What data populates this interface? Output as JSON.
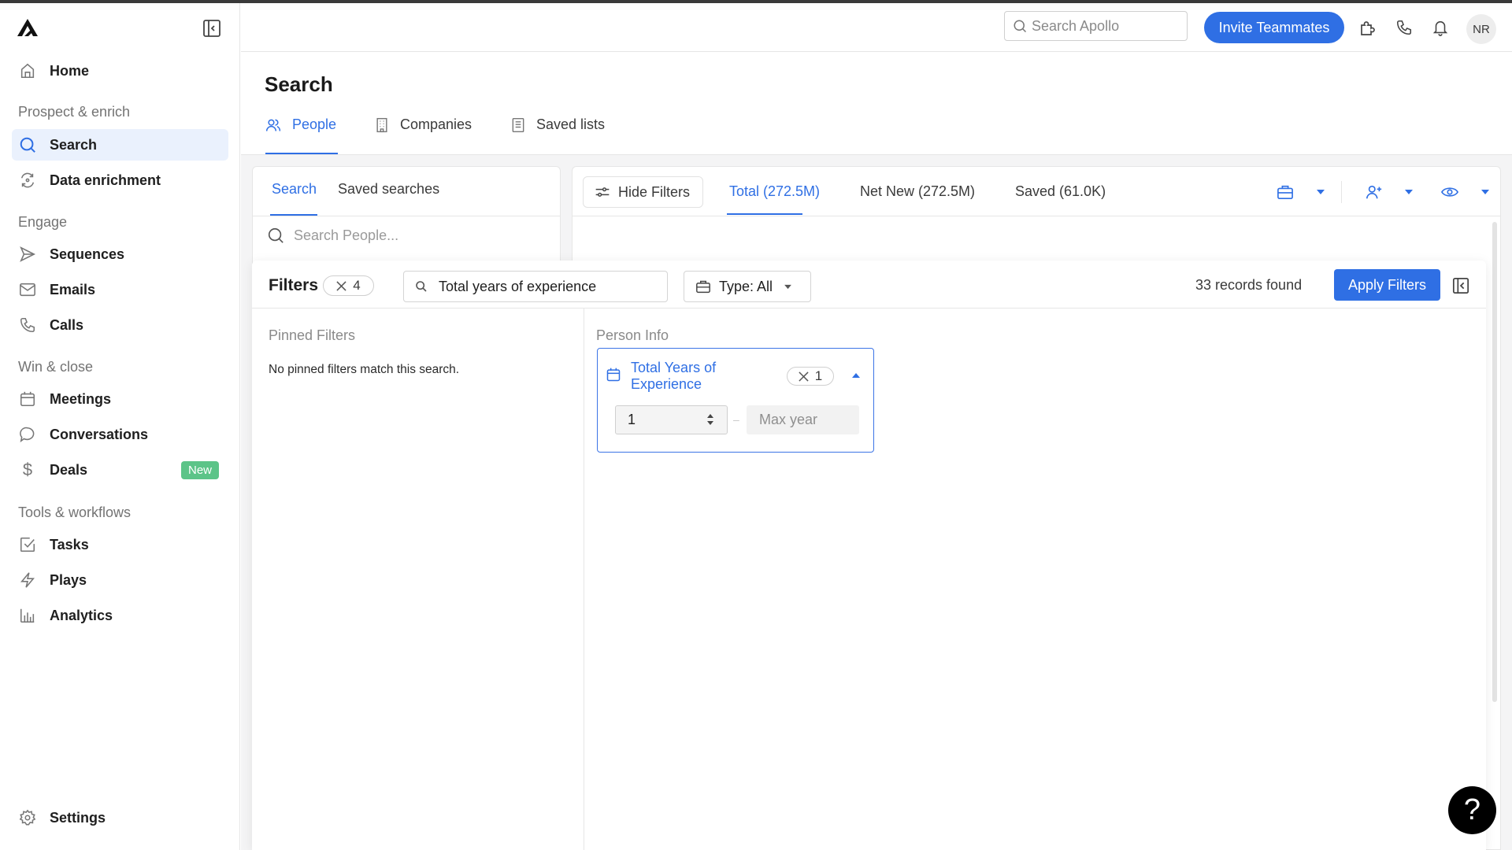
{
  "app": {
    "name": "Apollo"
  },
  "sidebar": {
    "home": {
      "label": "Home",
      "icon": "home-icon"
    },
    "sections": [
      {
        "title": "Prospect & enrich",
        "items": [
          {
            "label": "Search",
            "icon": "search-icon",
            "active": true
          },
          {
            "label": "Data enrichment",
            "icon": "refresh-icon"
          }
        ]
      },
      {
        "title": "Engage",
        "items": [
          {
            "label": "Sequences",
            "icon": "send-icon"
          },
          {
            "label": "Emails",
            "icon": "mail-icon"
          },
          {
            "label": "Calls",
            "icon": "phone-icon"
          }
        ]
      },
      {
        "title": "Win & close",
        "items": [
          {
            "label": "Meetings",
            "icon": "calendar-icon"
          },
          {
            "label": "Conversations",
            "icon": "chat-icon"
          },
          {
            "label": "Deals",
            "icon": "dollar-icon",
            "badge": "New"
          }
        ]
      },
      {
        "title": "Tools & workflows",
        "items": [
          {
            "label": "Tasks",
            "icon": "checkbox-icon"
          },
          {
            "label": "Plays",
            "icon": "lightning-icon"
          },
          {
            "label": "Analytics",
            "icon": "bar-chart-icon"
          }
        ]
      }
    ],
    "settings": {
      "label": "Settings",
      "icon": "gear-icon"
    }
  },
  "header": {
    "search_placeholder": "Search Apollo",
    "invite_label": "Invite Teammates",
    "avatar_initials": "NR"
  },
  "page": {
    "title": "Search",
    "tabs": [
      {
        "label": "People",
        "active": true
      },
      {
        "label": "Companies"
      },
      {
        "label": "Saved lists"
      }
    ]
  },
  "left_card": {
    "tabs": [
      {
        "label": "Search",
        "active": true
      },
      {
        "label": "Saved searches"
      }
    ],
    "search_placeholder": "Search People..."
  },
  "right_card": {
    "hide_filters_label": "Hide Filters",
    "tabs": [
      {
        "label": "Total (272.5M)",
        "active": true
      },
      {
        "label": "Net New (272.5M)"
      },
      {
        "label": "Saved (61.0K)"
      }
    ]
  },
  "filters": {
    "title": "Filters",
    "count": "4",
    "search_value": "Total years of experience",
    "type_label": "Type: All",
    "records_found": "33 records found",
    "apply_label": "Apply Filters",
    "pinned_title": "Pinned Filters",
    "pinned_empty": "No pinned filters match this search.",
    "section_title": "Person Info",
    "card": {
      "title": "Total Years of Experience",
      "count": "1",
      "min_value": "1",
      "max_placeholder": "Max year",
      "separator": "–"
    }
  },
  "help": {
    "label": "?"
  },
  "colors": {
    "accent": "#2f6fe4",
    "badge_green": "#5cc488",
    "active_bg": "#eaf1fd"
  }
}
